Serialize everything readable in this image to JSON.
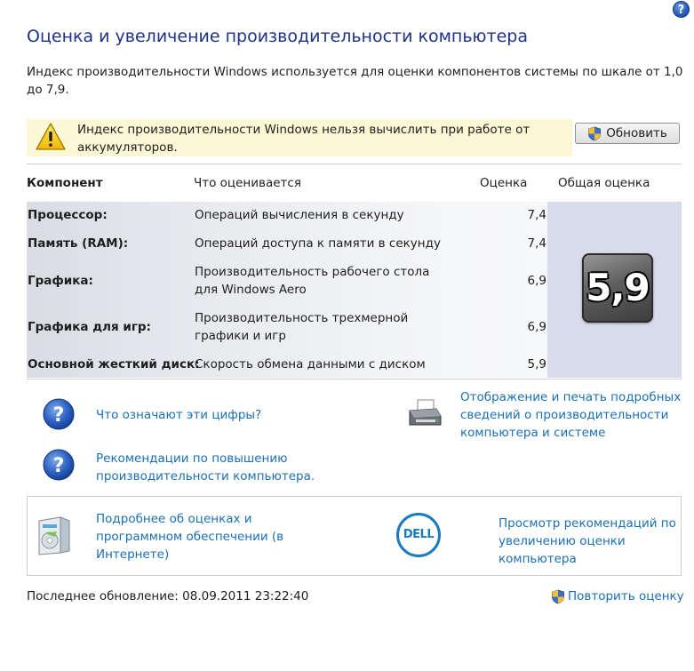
{
  "page": {
    "title": "Оценка и увеличение производительности компьютера",
    "description": "Индекс производительности Windows используется для оценки компонентов системы по шкале от 1,0 до 7,9.",
    "help_label": "?"
  },
  "warning": {
    "text": "Индекс производительности Windows нельзя вычислить при работе от аккумуляторов.",
    "button_label": "Обновить"
  },
  "table": {
    "headers": {
      "component": "Компонент",
      "what": "Что оценивается",
      "score": "Оценка",
      "overall": "Общая оценка"
    },
    "rows": [
      {
        "label": "Процессор:",
        "desc": "Операций вычисления в секунду",
        "value": "7,4"
      },
      {
        "label": "Память (RAM):",
        "desc": "Операций доступа к памяти в секунду",
        "value": "7,4"
      },
      {
        "label": "Графика:",
        "desc": "Производительность рабочего стола для Windows Aero",
        "value": "6,9"
      },
      {
        "label": "Графика для игр:",
        "desc": "Производительность трехмерной графики и игр",
        "value": "6,9"
      },
      {
        "label": "Основной жесткий диск:",
        "desc": "Скорость обмена данными с диском",
        "value": "5,9"
      }
    ],
    "overall_score": "5,9"
  },
  "links": {
    "what_numbers": "Что означают эти цифры?",
    "print_details": "Отображение и печать подробных сведений о производительности компьютера и системе",
    "tips": "Рекомендации по повышению производительности компьютера.",
    "online_info": "Подробнее об оценках и программном обеспечении (в Интернете)",
    "dell_tips": "Просмотр рекомендаций по увеличению оценки компьютера",
    "dell_logo": "DELL"
  },
  "footer": {
    "last_update": "Последнее обновление: 08.09.2011 23:22:40",
    "rerun": "Повторить оценку"
  },
  "icons": [
    "help-icon",
    "warning-icon",
    "shield-icon",
    "question-icon",
    "printer-icon",
    "software-box-icon",
    "dell-logo"
  ],
  "colors": {
    "title": "#1e3287",
    "link": "#1a6fb5",
    "warning_bg": "#fcf8d6",
    "score_col": "#d8dbea"
  }
}
